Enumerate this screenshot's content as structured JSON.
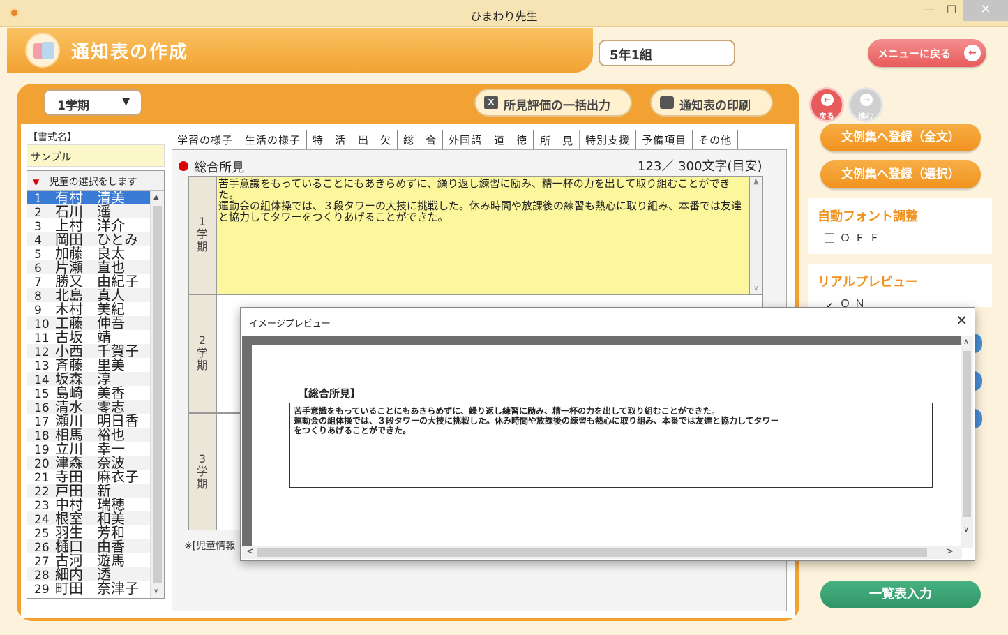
{
  "window": {
    "title": "ひまわり先生",
    "min": "—",
    "max": "☐",
    "close": "✕"
  },
  "header": {
    "title": "通知表の作成",
    "class_name": "5年1組",
    "menu_label": "メニューに戻る",
    "menu_arrow": "←"
  },
  "toolbar": {
    "term": "1学期",
    "term_caret": "▼",
    "bulk_export": "所見評価の一括出力",
    "print": "通知表の印刷",
    "excel_icon": "X"
  },
  "left": {
    "format_label": "【書式名】",
    "format_value": "サンプル",
    "list_header": "児童の選択をします",
    "list_header_icon": "▼",
    "scroll_up": "▲",
    "scroll_down": "∨",
    "students": [
      {
        "no": "1",
        "name": "有村　清美"
      },
      {
        "no": "2",
        "name": "石川　遥"
      },
      {
        "no": "3",
        "name": "上村　洋介"
      },
      {
        "no": "4",
        "name": "岡田　ひとみ"
      },
      {
        "no": "5",
        "name": "加藤　良太"
      },
      {
        "no": "6",
        "name": "片瀬　直也"
      },
      {
        "no": "7",
        "name": "勝又　由紀子"
      },
      {
        "no": "8",
        "name": "北島　真人"
      },
      {
        "no": "9",
        "name": "木村　美紀"
      },
      {
        "no": "10",
        "name": "工藤　伸吾"
      },
      {
        "no": "11",
        "name": "古坂　靖"
      },
      {
        "no": "12",
        "name": "小西　千賀子"
      },
      {
        "no": "13",
        "name": "斉藤　里美"
      },
      {
        "no": "14",
        "name": "坂森　淳"
      },
      {
        "no": "15",
        "name": "島崎　美香"
      },
      {
        "no": "16",
        "name": "清水　零志"
      },
      {
        "no": "17",
        "name": "瀬川　明日香"
      },
      {
        "no": "18",
        "name": "相馬　裕也"
      },
      {
        "no": "19",
        "name": "立川　幸一"
      },
      {
        "no": "20",
        "name": "津森　奈波"
      },
      {
        "no": "21",
        "name": "寺田　麻衣子"
      },
      {
        "no": "22",
        "name": "戸田　新"
      },
      {
        "no": "23",
        "name": "中村　瑞穂"
      },
      {
        "no": "24",
        "name": "根室　和美"
      },
      {
        "no": "25",
        "name": "羽生　芳和"
      },
      {
        "no": "26",
        "name": "樋口　由香"
      },
      {
        "no": "27",
        "name": "古河　遊馬"
      },
      {
        "no": "28",
        "name": "細内　透"
      },
      {
        "no": "29",
        "name": "町田　奈津子"
      }
    ]
  },
  "tabs": [
    "学習の様子",
    "生活の様子",
    "特　活",
    "出　欠",
    "総　合",
    "外国語",
    "道　徳",
    "所　見",
    "特別支援",
    "予備項目",
    "その他"
  ],
  "content": {
    "section_label": "総合所見",
    "char_count": "123／ 300文字(目安)",
    "term1_label": [
      "1",
      "学",
      "期"
    ],
    "term2_label": [
      "2",
      "学",
      "期"
    ],
    "term3_label": [
      "3",
      "学",
      "期"
    ],
    "term1_text": "苦手意識をもっていることにもあきらめずに、繰り返し練習に励み、精一杯の力を出して取り組むことができた。\n運動会の組体操では、３段タワーの大技に挑戦した。休み時間や放課後の練習も熱心に取り組み、本番では友達と協力してタワーをつくりあげることができた。",
    "note": "※[児童情報"
  },
  "right": {
    "back": "戻る",
    "forward": "進む",
    "back_arrow": "←",
    "forward_arrow": "→",
    "register_all": "文例集へ登録（全文）",
    "register_sel": "文例集へ登録（選択）",
    "auto_font_title": "自動フォント調整",
    "auto_font_value": "ＯＦＦ",
    "preview_title": "リアルプレビュー",
    "preview_value": "ＯＮ",
    "preview_check": "✔",
    "list_input": "一覧表入力"
  },
  "dialog": {
    "title": "イメージプレビュー",
    "close": "✕",
    "heading": "【総合所見】",
    "text": "苦手意識をもっていることにもあきらめずに、繰り返し練習に励み、精一杯の力を出して取り組むことができた。\n運動会の組体操では、３段タワーの大技に挑戦した。休み時間や放課後の練習も熱心に取り組み、本番では友達と協力してタワー\nをつくりあげることができた。",
    "scroll_up": "∧",
    "scroll_down": "∨",
    "scroll_left": "<",
    "scroll_right": ">"
  }
}
